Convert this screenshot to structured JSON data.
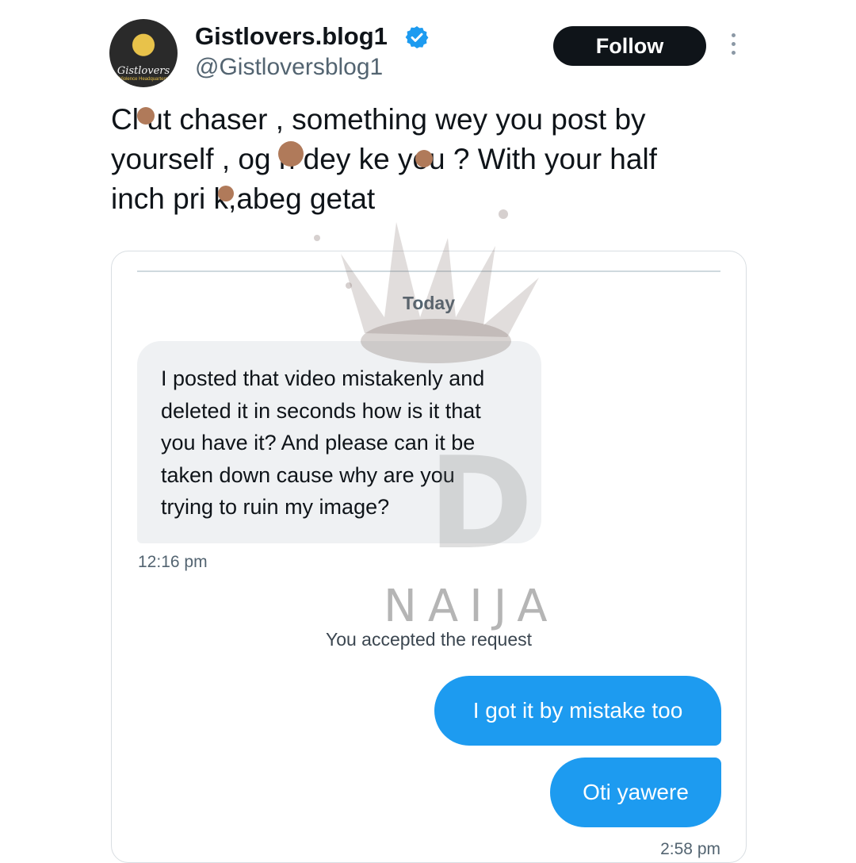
{
  "account": {
    "display_name": "Gistlovers.blog1",
    "handle": "@Gistloversblog1",
    "avatar_text": "Gistlovers",
    "avatar_subtext": "Violence Headquarters",
    "verified": true
  },
  "actions": {
    "follow_label": "Follow"
  },
  "tweet": {
    "lines": [
      "Cl  ut chaser , something wey you post by",
      "yourself , og  n dey ke  you ? With your half",
      "inch pri  k,abeg getat"
    ]
  },
  "dm": {
    "date_label": "Today",
    "incoming_lines": [
      "I posted that video mistakenly and",
      "deleted it in seconds how is it that",
      "you have it? And please can it be",
      "taken down cause why are you",
      "trying to ruin my image?"
    ],
    "incoming_time": "12:16 pm",
    "system_message": "You accepted the request",
    "outgoing": [
      "I got it by mistake too",
      "Oti yawere"
    ],
    "outgoing_time": "2:58 pm"
  },
  "watermark": {
    "text": "NAIJA",
    "letter": "D"
  },
  "colors": {
    "accent": "#1d9bf0",
    "follow_bg": "#0f1419",
    "redaction": "#b07a5a"
  },
  "icons": [
    "verified-badge-icon",
    "more-options-icon"
  ]
}
